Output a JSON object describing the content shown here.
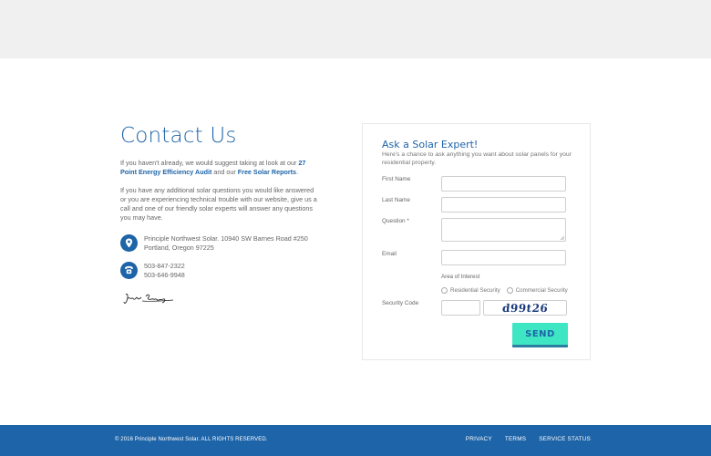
{
  "contact": {
    "title": "Contact Us",
    "para1_a": "If you haven't already, we would suggest taking at look at our ",
    "para1_link1": "27 Point Energy Efficiency Audit",
    "para1_b": " and our ",
    "para1_link2": "Free Solar Reports",
    "para1_c": ".",
    "para2": "If you have any additional solar questions you would like answered or you are experiencing technical trouble with our website, give us a call and one of our friendly solar experts will answer any questions you may have.",
    "address_line1": "Principle Northwest Solar. 10940 SW Barnes Road #250",
    "address_line2": "Portland, Oregon 97225",
    "phone1": "503-847-2322",
    "phone2": "503-646-9948",
    "location_icon": "location-pin-icon",
    "phone_icon": "phone-icon"
  },
  "form": {
    "title": "Ask a Solar Expert!",
    "subtitle": "Here's a chance to ask anything you want about solar panels for your residential property.",
    "first_name_label": "First Name",
    "last_name_label": "Last Name",
    "question_label": "Question *",
    "email_label": "Email",
    "area_label": "Area of Interest",
    "option_residential": "Residential Security",
    "option_commercial": "Commercial Security",
    "security_label": "Security Code",
    "captcha_text": "d99t26",
    "send_label": "SEND"
  },
  "footer": {
    "copyright": "© 2016 Principle Northwest Solar. ALL RIGHTS RESERVED.",
    "links": [
      "PRIVACY",
      "TERMS",
      "SERVICE STATUS"
    ]
  },
  "colors": {
    "brand_blue": "#1e64a8",
    "send_button": "#3fe6c4"
  }
}
